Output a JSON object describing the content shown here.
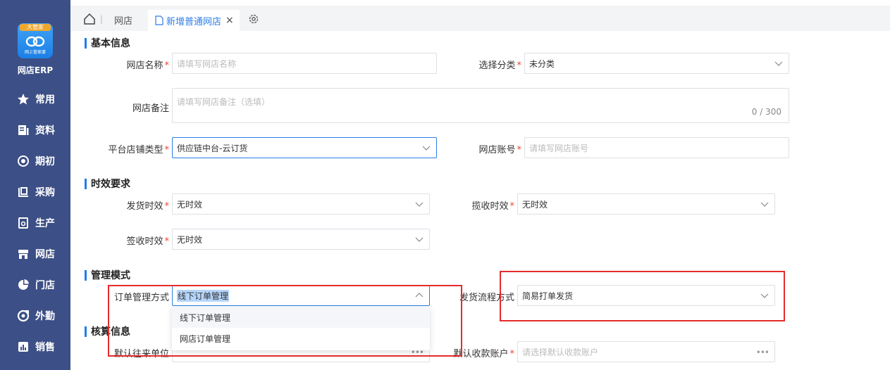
{
  "sidebar": {
    "logo_ribbon": "大管家",
    "logo_sub": "网上管家婆",
    "brand": "网店ERP",
    "items": [
      {
        "label": "常用",
        "icon": "star-icon"
      },
      {
        "label": "资料",
        "icon": "document-icon"
      },
      {
        "label": "期初",
        "icon": "target-icon"
      },
      {
        "label": "采购",
        "icon": "shop-cart-icon"
      },
      {
        "label": "生产",
        "icon": "production-icon"
      },
      {
        "label": "网店",
        "icon": "store-icon"
      },
      {
        "label": "门店",
        "icon": "pie-icon"
      },
      {
        "label": "外勤",
        "icon": "field-icon"
      },
      {
        "label": "销售",
        "icon": "chart-icon"
      }
    ]
  },
  "tabs": {
    "tab1": "网店",
    "active": "新增普通网店",
    "close": "×"
  },
  "sections": {
    "basic": "基本信息",
    "timing": "时效要求",
    "management": "管理模式",
    "accounting": "核算信息"
  },
  "basic": {
    "store_name_label": "网店名称",
    "store_name_placeholder": "请填写网店名称",
    "category_label": "选择分类",
    "category_value": "未分类",
    "remark_label": "网店备注",
    "remark_placeholder": "请填写网店备注（选填）",
    "remark_counter": "0 / 300",
    "platform_label": "平台店铺类型",
    "platform_value": "供应链中台-云订货",
    "account_label": "网店账号",
    "account_placeholder": "请填写网店账号",
    "required_mark": "*"
  },
  "timing": {
    "ship_label": "发货时效",
    "ship_value": "无时效",
    "pickup_label": "揽收时效",
    "pickup_value": "无时效",
    "sign_label": "签收时效",
    "sign_value": "无时效"
  },
  "management": {
    "order_label": "订单管理方式",
    "order_value": "线下订单管理",
    "ship_flow_label": "发货流程方式",
    "ship_flow_value": "简易打单发货",
    "options": [
      "线下订单管理",
      "网店订单管理"
    ]
  },
  "accounting": {
    "partner_label": "默认往来单位",
    "account_label": "默认收款账户",
    "account_placeholder": "请选择默认收款账户",
    "dots": "•••"
  },
  "colors": {
    "sidebar": "#3c4f86",
    "accent": "#2b7de9",
    "highlight": "#e52b2b"
  }
}
